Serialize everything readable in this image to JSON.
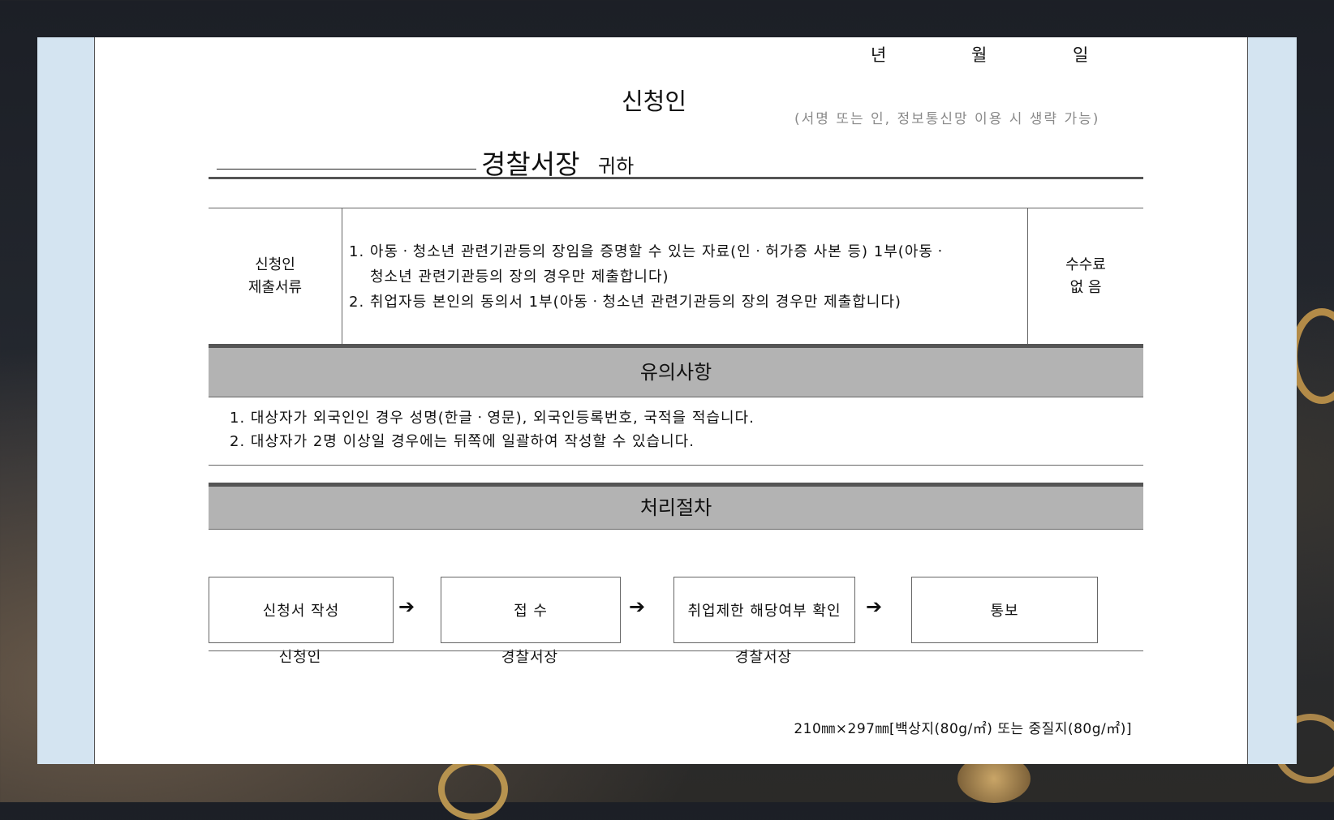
{
  "header": {
    "date_year": "년",
    "date_month": "월",
    "date_day": "일",
    "applicant_label": "신청인",
    "signature_note": "(서명 또는 인, 정보통신망 이용 시 생략 가능)",
    "station": "경찰서장",
    "honorific": "귀하"
  },
  "documents": {
    "head_line1": "신청인",
    "head_line2": "제출서류",
    "item1_line1": "1. 아동ㆍ청소년 관련기관등의 장임을 증명할 수 있는 자료(인ㆍ허가증 사본 등) 1부(아동ㆍ",
    "item1_line2": "청소년 관련기관등의 장의 경우만 제출합니다)",
    "item2": "2. 취업자등 본인의 동의서 1부(아동ㆍ청소년 관련기관등의 장의 경우만 제출합니다)",
    "fee_line1": "수수료",
    "fee_line2": "없 음"
  },
  "notices": {
    "title": "유의사항",
    "items": [
      "1. 대상자가 외국인인 경우 성명(한글ㆍ영문), 외국인등록번호, 국적을 적습니다.",
      "2. 대상자가 2명 이상일 경우에는 뒤쪽에 일괄하여 작성할 수 있습니다."
    ]
  },
  "procedure": {
    "title": "처리절차",
    "arrow": "➔",
    "steps": [
      {
        "label": "신청서 작성",
        "who": "신청인"
      },
      {
        "label": "접 수",
        "who": "경찰서장"
      },
      {
        "label": "취업제한 해당여부 확인",
        "who": "경찰서장"
      },
      {
        "label": "통보",
        "who": ""
      }
    ]
  },
  "footer": {
    "paper_spec": "210㎜×297㎜[백상지(80g/㎡) 또는 중질지(80g/㎡)]"
  }
}
